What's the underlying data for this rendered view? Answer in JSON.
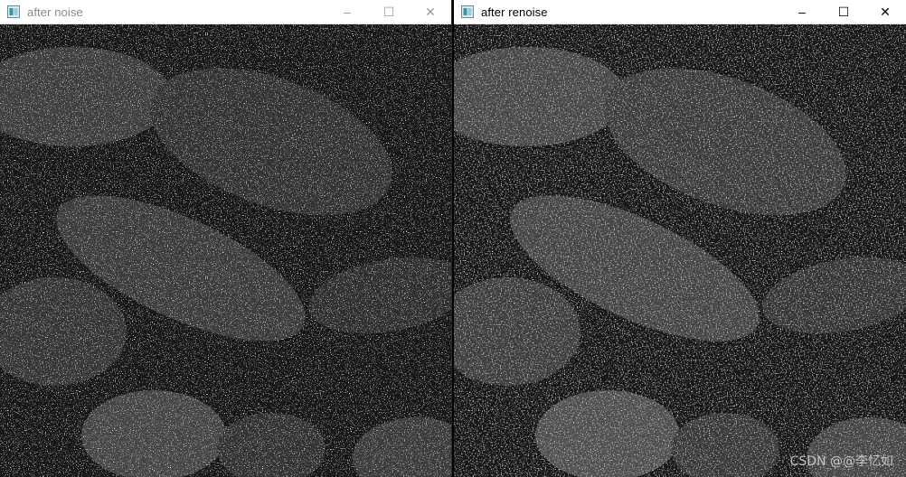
{
  "windows": [
    {
      "title": "after noise",
      "active": false,
      "controls": {
        "minimize": "–",
        "maximize": "☐",
        "close": "✕"
      }
    },
    {
      "title": "after renoise",
      "active": true,
      "controls": {
        "minimize": "–",
        "maximize": "☐",
        "close": "✕"
      }
    }
  ],
  "watermark": "CSDN @@李忆如",
  "icons": {
    "app": "opencv-window-icon",
    "minimize": "minimize-icon",
    "maximize": "maximize-icon",
    "close": "close-icon"
  }
}
